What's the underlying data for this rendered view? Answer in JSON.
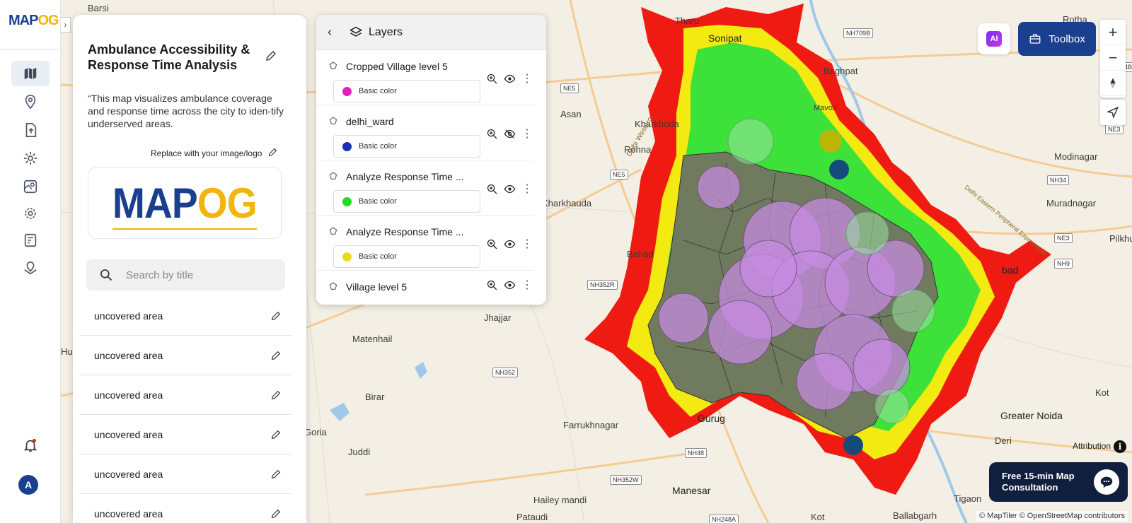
{
  "app": {
    "logo_main": "MAP",
    "logo_accent": "OG"
  },
  "sidebar": {
    "items": [
      {
        "name": "map-icon",
        "active": true
      },
      {
        "name": "location-pin-icon"
      },
      {
        "name": "upload-icon"
      },
      {
        "name": "gear-icon"
      },
      {
        "name": "map-search-icon"
      },
      {
        "name": "settings-icon"
      },
      {
        "name": "report-icon"
      },
      {
        "name": "map-layers-pin-icon"
      }
    ],
    "avatar_initial": "A",
    "collapse_glyph": "›"
  },
  "panel": {
    "title": "Ambulance Accessibility & Response Time Analysis",
    "description": "“This map visualizes ambulance coverage and response time across the city to iden-tify underserved areas.",
    "replace_label": "Replace with your image/logo",
    "logo_text_main": "MAP",
    "logo_text_accent": "OG",
    "search_placeholder": "Search by title",
    "list": [
      "uncovered area",
      "uncovered area",
      "uncovered area",
      "uncovered area",
      "uncovered area",
      "uncovered area"
    ]
  },
  "layers": {
    "title": "Layers",
    "items": [
      {
        "name": "Cropped Village level 5",
        "style": "Basic color",
        "color": "#e81ec1",
        "visible": true
      },
      {
        "name": "delhi_ward",
        "style": "Basic color",
        "color": "#1a2fb8",
        "visible": false
      },
      {
        "name": "Analyze Response Time ...",
        "style": "Basic color",
        "color": "#22dd22",
        "visible": true
      },
      {
        "name": "Analyze Response Time ...",
        "style": "Basic color",
        "color": "#e8dc1a",
        "visible": true
      },
      {
        "name": "Village level 5",
        "style": "",
        "color": "",
        "visible": true
      }
    ]
  },
  "toolbar": {
    "ai_label": "AI",
    "toolbox_label": "Toolbox",
    "zoom_in": "+",
    "zoom_out": "−"
  },
  "consult": {
    "label": "Free 15-min Map Consultation"
  },
  "map": {
    "places": [
      {
        "label": "Barsi"
      },
      {
        "label": "Tharu"
      },
      {
        "label": "Rotha"
      },
      {
        "label": "Sonipat"
      },
      {
        "label": "Baghpat"
      },
      {
        "label": "Kharkhoda"
      },
      {
        "label": "Asan"
      },
      {
        "label": "Rohna"
      },
      {
        "label": "Kharkhauda"
      },
      {
        "label": "Modinagar"
      },
      {
        "label": "Muradnagar"
      },
      {
        "label": "Bahad"
      },
      {
        "label": "Jhajjar"
      },
      {
        "label": "Matenhail"
      },
      {
        "label": "Birar"
      },
      {
        "label": "Goria"
      },
      {
        "label": "Juddi"
      },
      {
        "label": "Farrukhnagar"
      },
      {
        "label": "Gurug"
      },
      {
        "label": "Manesar"
      },
      {
        "label": "Hailey mandi"
      },
      {
        "label": "Pataudi"
      },
      {
        "label": "Kot"
      },
      {
        "label": "Ballabgarh"
      },
      {
        "label": "Tigaon"
      },
      {
        "label": "Deri"
      },
      {
        "label": "Greater Noida"
      },
      {
        "label": "Kot"
      },
      {
        "label": "Pilkhuv"
      },
      {
        "label": "Hulk"
      },
      {
        "label": "bad"
      },
      {
        "label": "Mavoli"
      }
    ],
    "shields": [
      {
        "label": "NH709B"
      },
      {
        "label": "NH334B"
      },
      {
        "label": "NE5"
      },
      {
        "label": "NE5"
      },
      {
        "label": "NE3"
      },
      {
        "label": "NH34"
      },
      {
        "label": "NE3"
      },
      {
        "label": "NH9"
      },
      {
        "label": "NH352R"
      },
      {
        "label": "NH352"
      },
      {
        "label": "NH48"
      },
      {
        "label": "NH352W"
      },
      {
        "label": "NH248A"
      }
    ],
    "road_labels": [
      {
        "label": "Delhi Western"
      },
      {
        "label": "Delhi Eastern Peripheral Expressway"
      }
    ],
    "attribution_label": "Attribution",
    "attribution": "© MapTiler © OpenStreetMap contributors"
  }
}
